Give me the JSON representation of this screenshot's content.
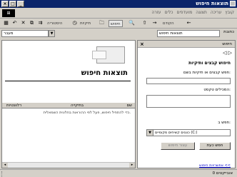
{
  "window": {
    "title": "תוצאות חיפוש",
    "minimize_glyph": "_",
    "maximize_glyph": "□",
    "close_glyph": "×"
  },
  "menubar": {
    "logo": "⊞",
    "items": [
      "קובץ",
      "עריכה",
      "תצוגה",
      "מועדפים",
      "כלים",
      "עזרה"
    ]
  },
  "toolbar": {
    "back_label": "הקודם",
    "search_label": "חיפוש",
    "folders_label": "תיקיות",
    "history_label": "היסטוריה"
  },
  "addressbar": {
    "label": "כתובת",
    "value": "תוצאות חיפוש",
    "go_label": "מעבר"
  },
  "results": {
    "title": "תוצאות חיפוש",
    "columns": [
      "שם",
      "בתיקייה",
      "רלוונטיות"
    ],
    "empty_text": "כדי להתחיל חיפוש, פעל לפי ההוראות בחלונית השמאלית."
  },
  "search": {
    "pane_title": "חיפוש",
    "heading": "חיפוש קבצים ותיקיות",
    "name_label": "חפש קבצים או תיקיות בשם:",
    "name_value": "",
    "text_label": "המכילים טקסט:",
    "text_value": "",
    "lookin_label": "חפש ב:",
    "lookin_value": "כוננים קשיחים מקומיים (C:)",
    "search_button": "חפש כעת",
    "stop_button": "עצור חיפוש",
    "options_link": "אפשרויות חיפוש <<"
  },
  "status": {
    "text": "0 אובייקטים"
  }
}
